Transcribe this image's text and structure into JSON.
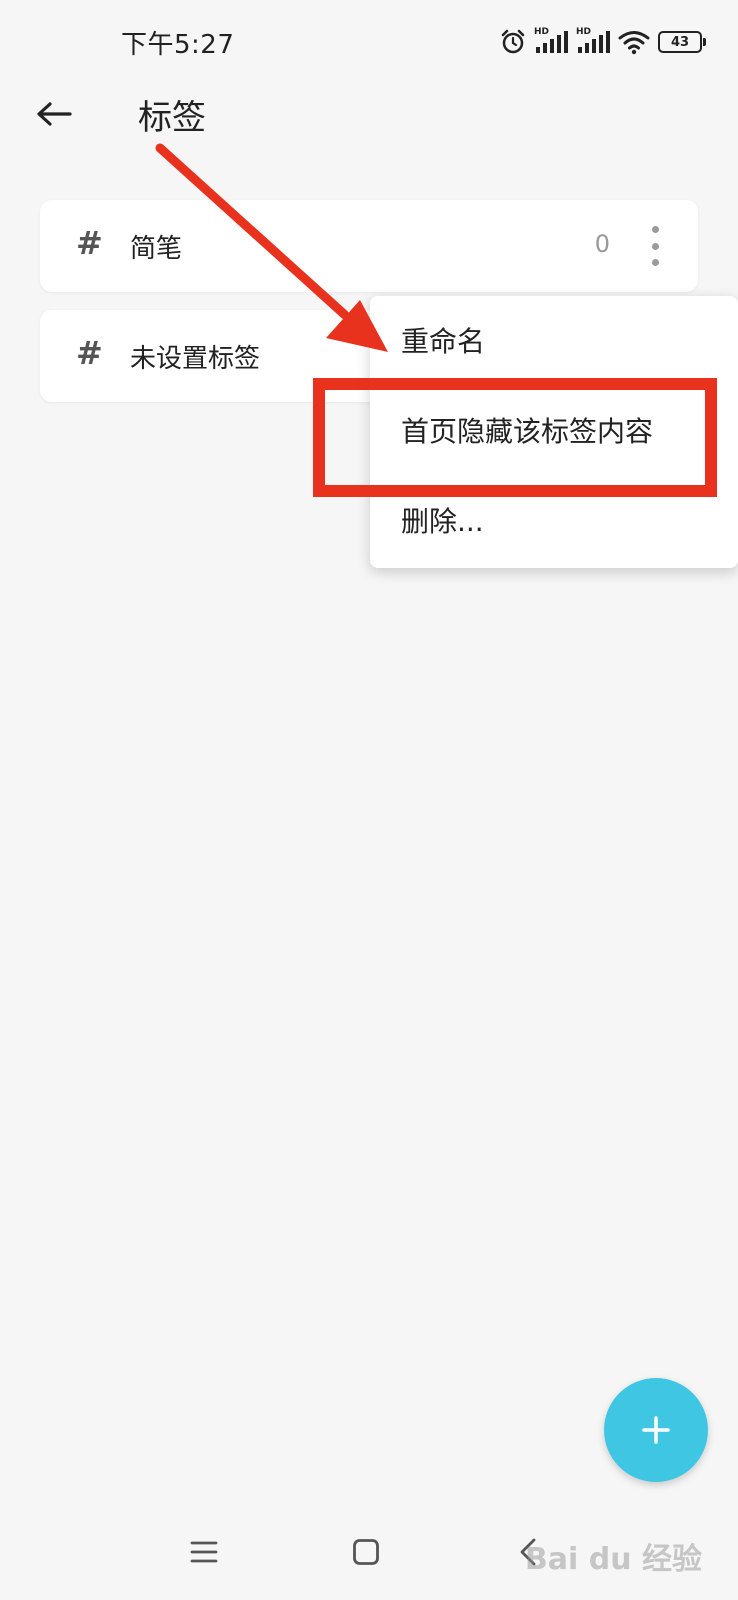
{
  "status_bar": {
    "time": "下午5:27",
    "hd1": "HD",
    "hd2": "HD",
    "battery": "43"
  },
  "header": {
    "title": "标签"
  },
  "tags": [
    {
      "hash": "#",
      "label": "简笔",
      "count": "0"
    },
    {
      "hash": "#",
      "label": "未设置标签"
    }
  ],
  "menu": {
    "items": [
      "重命名",
      "首页隐藏该标签内容",
      "删除..."
    ]
  },
  "fab": {
    "label": "+"
  },
  "watermark": {
    "text": "Bai du 经验"
  },
  "colors": {
    "accent": "#3fc6e3",
    "annotation_red": "#e8321e",
    "background": "#f6f6f6"
  }
}
